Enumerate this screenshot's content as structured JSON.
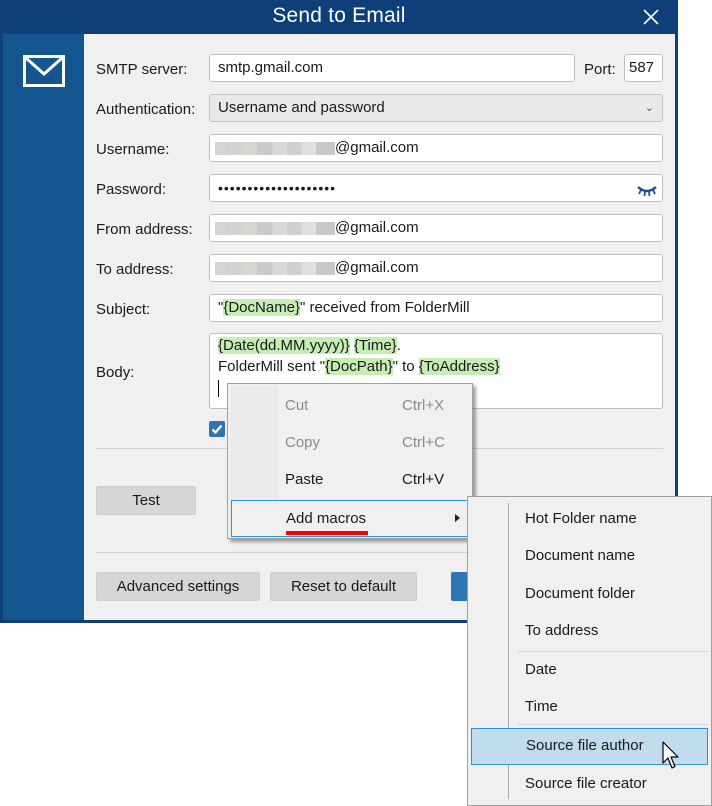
{
  "window": {
    "title": "Send to Email",
    "close_icon": "close-icon",
    "sidebar_icon": "envelope-icon"
  },
  "form": {
    "smtp_server": {
      "label": "SMTP server:",
      "value": "smtp.gmail.com"
    },
    "port": {
      "label": "Port:",
      "value": "587"
    },
    "authentication": {
      "label": "Authentication:",
      "value": "Username and password"
    },
    "username": {
      "label": "Username:",
      "value_suffix": "@gmail.com"
    },
    "password": {
      "label": "Password:",
      "value": "••••••••••••••••••••",
      "toggle_icon": "eye-closed-icon"
    },
    "from_address": {
      "label": "From address:",
      "value_suffix": "@gmail.com"
    },
    "to_address": {
      "label": "To address:",
      "value_suffix": "@gmail.com"
    },
    "subject": {
      "label": "Subject:",
      "parts": [
        "\"",
        "{DocName}",
        "\" received from FolderMill"
      ]
    },
    "body": {
      "label": "Body:",
      "line1": [
        "{Date(dd.MM.yyyy)}",
        " ",
        "{Time}",
        "."
      ],
      "line2": [
        "FolderMill sent \"",
        "{DocPath}",
        "\" to ",
        "{ToAddress}"
      ]
    },
    "checkbox_checked": true
  },
  "buttons": {
    "test": "Test",
    "advanced_settings": "Advanced settings",
    "reset_to_default": "Reset to default"
  },
  "context_menu": {
    "items": [
      {
        "label": "Cut",
        "shortcut": "Ctrl+X",
        "enabled": false
      },
      {
        "label": "Copy",
        "shortcut": "Ctrl+C",
        "enabled": false
      },
      {
        "label": "Paste",
        "shortcut": "Ctrl+V",
        "enabled": true
      },
      {
        "label": "Add macros",
        "shortcut": "",
        "enabled": true,
        "submenu": true,
        "highlighted": true
      }
    ]
  },
  "macros_submenu": {
    "items": [
      {
        "label": "Hot Folder name"
      },
      {
        "label": "Document name"
      },
      {
        "label": "Document folder"
      },
      {
        "label": "To address"
      },
      {
        "label": "Date"
      },
      {
        "label": "Time"
      },
      {
        "label": "Source file author",
        "highlighted": true
      },
      {
        "label": "Source file creator"
      }
    ]
  },
  "colors": {
    "titlebar": "#0e3f78",
    "sidebar": "#13568f",
    "macro_highlight": "#c6edb4",
    "accent": "#2f74b5",
    "annotation_underline": "#ff0000"
  }
}
